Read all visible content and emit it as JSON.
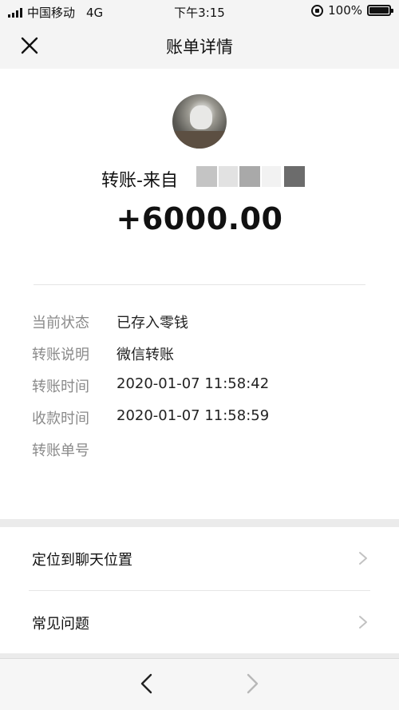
{
  "status_bar": {
    "carrier": "中国移动",
    "network": "4G",
    "time": "下午3:15",
    "battery": "100%",
    "icons": [
      "signal-icon",
      "orientation-lock-icon",
      "battery-icon"
    ]
  },
  "nav": {
    "title": "账单详情",
    "close_icon": "close-icon"
  },
  "transfer": {
    "from_label": "转账-来自",
    "amount": "+6000.00"
  },
  "details": [
    {
      "label": "当前状态",
      "value": "已存入零钱"
    },
    {
      "label": "转账说明",
      "value": "微信转账"
    },
    {
      "label": "转账时间",
      "value": "2020-01-07 11:58:42"
    },
    {
      "label": "收款时间",
      "value": "2020-01-07 11:58:59"
    },
    {
      "label": "转账单号",
      "value": ""
    }
  ],
  "menu": [
    {
      "label": "定位到聊天位置",
      "icon": "chevron-right-icon"
    },
    {
      "label": "常见问题",
      "icon": "chevron-right-icon"
    }
  ],
  "bottom_nav": {
    "back_icon": "chevron-left-icon",
    "forward_icon": "chevron-right-icon"
  },
  "colors": {
    "page_bg": "#ebebeb",
    "card_bg": "#ffffff",
    "label_gray": "#8a8a8a"
  }
}
